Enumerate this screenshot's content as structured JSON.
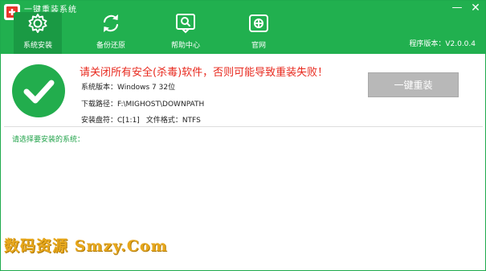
{
  "app": {
    "title": "一键重装系统"
  },
  "window_controls": {
    "minimize": "—",
    "close": "✕"
  },
  "tabs": [
    {
      "label": "系统安装",
      "icon": "gear-icon",
      "active": true
    },
    {
      "label": "备份还原",
      "icon": "refresh-icon",
      "active": false
    },
    {
      "label": "帮助中心",
      "icon": "help-chat-icon",
      "active": false
    },
    {
      "label": "官网",
      "icon": "website-icon",
      "active": false
    }
  ],
  "version": "程序版本：V2.0.0.4",
  "status": {
    "warning": "请关闭所有安全(杀毒)软件，否则可能导致重装失败！",
    "os_label": "系统版本：",
    "os_value": "Windows 7 32位",
    "path_label": "下载路径：",
    "path_value": "F:\\MIGHOST\\DOWNPATH",
    "disk_label": "安装盘符：",
    "disk_value": "C[1:1]",
    "fs_label": "文件格式：",
    "fs_value": "NTFS"
  },
  "action": {
    "reinstall_label": "一键重装"
  },
  "select_prompt": "请选择要安装的系统：",
  "watermark": "数码资源 Smzy.Com",
  "colors": {
    "brand_green": "#21b04f",
    "warning_red": "#e8291e",
    "button_gray": "#b8b8b8"
  }
}
